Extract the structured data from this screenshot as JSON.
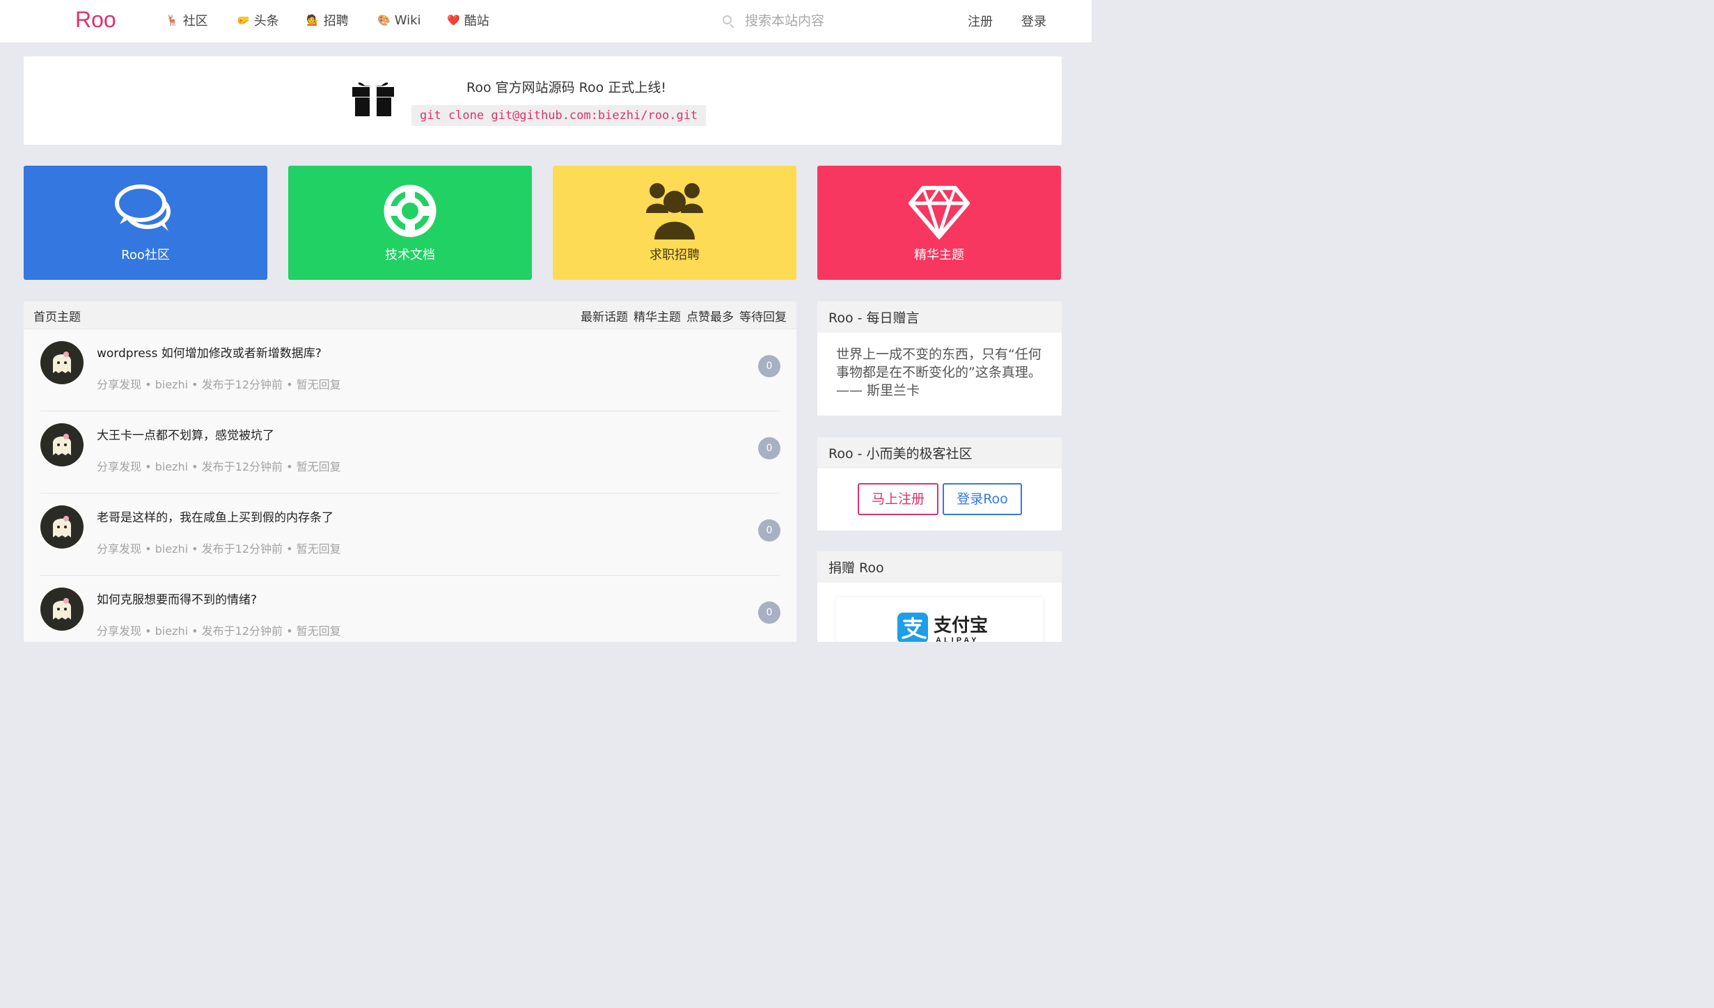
{
  "navbar": {
    "brand": "Roo",
    "items": [
      {
        "emoji": "🦌",
        "label": "社区"
      },
      {
        "emoji": "🤛",
        "label": "头条"
      },
      {
        "emoji": "💁",
        "label": "招聘"
      },
      {
        "emoji": "🎨",
        "label": "Wiki"
      },
      {
        "emoji": "❤️",
        "label": "酷站"
      }
    ],
    "search_placeholder": "搜索本站内容",
    "register": "注册",
    "login": "登录"
  },
  "announcement": {
    "title": "Roo 官方网站源码 Roo 正式上线!",
    "code": "git clone git@github.com:biezhi/roo.git"
  },
  "tiles": [
    {
      "label": "Roo社区",
      "icon": "chat-bubbles-icon",
      "color": "#3477e0"
    },
    {
      "label": "技术文档",
      "icon": "life-ring-icon",
      "color": "#21d163"
    },
    {
      "label": "求职招聘",
      "icon": "users-icon",
      "color": "#fddb54"
    },
    {
      "label": "精华主题",
      "icon": "diamond-icon",
      "color": "#f7375f"
    }
  ],
  "topics": {
    "title": "首页主题",
    "filters": [
      "最新话题",
      "精华主题",
      "点赞最多",
      "等待回复"
    ],
    "items": [
      {
        "title": "wordpress 如何增加修改或者新增数据库?",
        "meta": "分享发现 • biezhi • 发布于12分钟前 • 暂无回复",
        "replies": "0"
      },
      {
        "title": "大王卡一点都不划算，感觉被坑了",
        "meta": "分享发现 • biezhi • 发布于12分钟前 • 暂无回复",
        "replies": "0"
      },
      {
        "title": "老哥是这样的，我在咸鱼上买到假的内存条了",
        "meta": "分享发现 • biezhi • 发布于12分钟前 • 暂无回复",
        "replies": "0"
      },
      {
        "title": "如何克服想要而得不到的情绪?",
        "meta": "分享发现 • biezhi • 发布于12分钟前 • 暂无回复",
        "replies": "0"
      }
    ]
  },
  "sidebar": {
    "quote": {
      "title": "Roo - 每日赠言",
      "text": "世界上一成不变的东西，只有“任何事物都是在不断变化的”这条真理。—— 斯里兰卡"
    },
    "community": {
      "title": "Roo - 小而美的极客社区",
      "register_button": "马上注册",
      "login_button": "登录Roo"
    },
    "donate": {
      "title": "捐赠 Roo",
      "alipay_cn": "支付宝",
      "alipay_en": "ALIPAY"
    }
  }
}
